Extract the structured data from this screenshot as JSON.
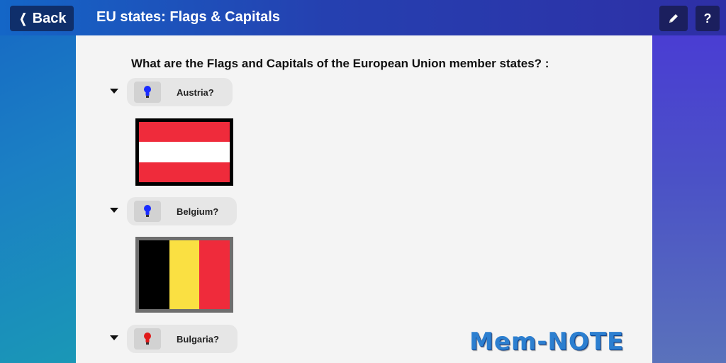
{
  "header": {
    "back_label": "Back",
    "title": "EU states: Flags & Capitals",
    "help_label": "?"
  },
  "main": {
    "question": "What are the Flags and Capitals of the European Union member states? :",
    "items": [
      {
        "label": "Austria?",
        "bulb_color": "#1a2cff",
        "flag_colors": [
          "#ef2b3b",
          "#ffffff",
          "#ef2b3b"
        ]
      },
      {
        "label": "Belgium?",
        "bulb_color": "#1a2cff",
        "flag_colors": [
          "#000000",
          "#fae042",
          "#ef2b3b"
        ]
      },
      {
        "label": "Bulgaria?",
        "bulb_color": "#e01a1a"
      }
    ],
    "logo_text": "Mem-NOTE"
  },
  "icons": {
    "back": "chevron-left-icon",
    "edit": "pencil-icon",
    "bulb": "lightbulb-icon",
    "expand": "caret-down-icon"
  }
}
